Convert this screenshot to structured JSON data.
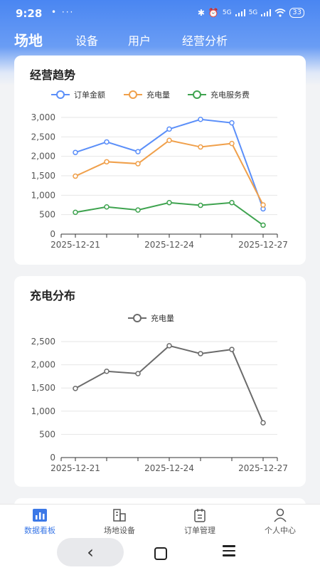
{
  "status_bar": {
    "time": "9:28",
    "left_icons": "• ···",
    "signal_1": "5G",
    "signal_2": "5G",
    "battery": "33"
  },
  "header_tabs": [
    {
      "label": "场地",
      "active": true
    },
    {
      "label": "设备",
      "active": false
    },
    {
      "label": "用户",
      "active": false
    },
    {
      "label": "经营分析",
      "active": false
    }
  ],
  "trend_card": {
    "title": "经营趋势"
  },
  "distribution_card": {
    "title": "充电分布"
  },
  "chart_data": [
    {
      "type": "line",
      "x": [
        "2025-12-21",
        "2025-12-22",
        "2025-12-23",
        "2025-12-24",
        "2025-12-25",
        "2025-12-26",
        "2025-12-27"
      ],
      "xticks": [
        "2025-12-21",
        "2025-12-24",
        "2025-12-27"
      ],
      "ylim": [
        0,
        3000
      ],
      "yticks": [
        "0",
        "500",
        "1,000",
        "1,500",
        "2,000",
        "2,500",
        "3,000"
      ],
      "grid": true,
      "legend_position": "top-center",
      "series": [
        {
          "name": "订单金额",
          "color": "#5b8ff9",
          "values": [
            2100,
            2370,
            2120,
            2700,
            2950,
            2860,
            650
          ]
        },
        {
          "name": "充电量",
          "color": "#f0a04b",
          "values": [
            1490,
            1860,
            1810,
            2410,
            2240,
            2330,
            750
          ]
        },
        {
          "name": "充电服务费",
          "color": "#3ea34f",
          "values": [
            560,
            700,
            620,
            810,
            740,
            810,
            230
          ]
        }
      ]
    },
    {
      "type": "line",
      "x": [
        "2025-12-21",
        "2025-12-22",
        "2025-12-23",
        "2025-12-24",
        "2025-12-25",
        "2025-12-26",
        "2025-12-27"
      ],
      "xticks": [
        "2025-12-21",
        "2025-12-24",
        "2025-12-27"
      ],
      "ylim": [
        0,
        2500
      ],
      "yticks": [
        "0",
        "500",
        "1,000",
        "1,500",
        "2,000",
        "2,500"
      ],
      "grid": true,
      "legend_position": "top-center",
      "series": [
        {
          "name": "充电量",
          "color": "#6b6b6b",
          "values": [
            1490,
            1860,
            1810,
            2410,
            2240,
            2330,
            750
          ]
        }
      ]
    }
  ],
  "bottom_nav": [
    {
      "label": "数据看板",
      "icon": "bar-chart-icon",
      "active": true
    },
    {
      "label": "场地设备",
      "icon": "building-icon",
      "active": false
    },
    {
      "label": "订单管理",
      "icon": "clipboard-icon",
      "active": false
    },
    {
      "label": "个人中心",
      "icon": "user-icon",
      "active": false
    }
  ],
  "colors": {
    "primary": "#4a86f2",
    "active_nav": "#3b78e7"
  }
}
